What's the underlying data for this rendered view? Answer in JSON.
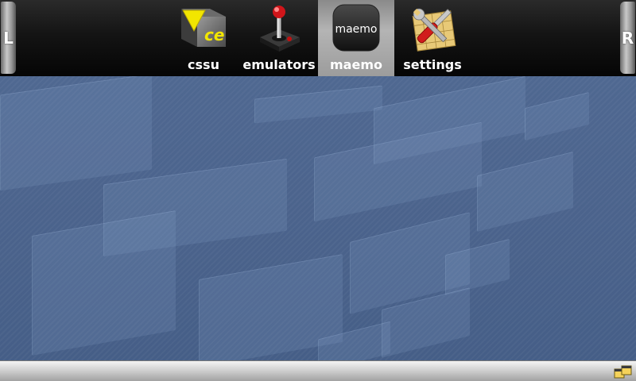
{
  "side_buttons": {
    "left_label": "L",
    "right_label": "R"
  },
  "tabs": [
    {
      "label": "cssu",
      "icon": "cssu-icon",
      "active": false
    },
    {
      "label": "emulators",
      "icon": "joystick-icon",
      "active": false
    },
    {
      "label": "maemo",
      "icon": "maemo-logo-icon",
      "logo_text": "maemo",
      "active": true
    },
    {
      "label": "settings",
      "icon": "tools-icon",
      "active": false
    }
  ],
  "cssu_logo_text": "ce",
  "colors": {
    "active_tab": "#a8a8a8",
    "wallpaper": "#4b648d",
    "topbar": "#111111",
    "bottombar": "#c8c8c8"
  },
  "bottom_bar": {
    "task_switcher_icon": "task-switcher-icon"
  }
}
